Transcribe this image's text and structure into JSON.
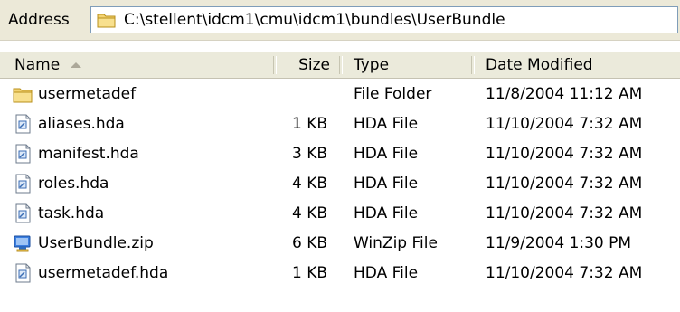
{
  "address": {
    "label": "Address",
    "path": "C:\\stellent\\idcm1\\cmu\\idcm1\\bundles\\UserBundle"
  },
  "columns": {
    "name": "Name",
    "size": "Size",
    "type": "Type",
    "date": "Date Modified",
    "sort_column": "name",
    "sort_direction": "ascending"
  },
  "files": [
    {
      "name": "usermetadef",
      "size": "",
      "type": "File Folder",
      "date": "11/8/2004 11:12 AM",
      "icon": "folder-icon"
    },
    {
      "name": "aliases.hda",
      "size": "1 KB",
      "type": "HDA File",
      "date": "11/10/2004 7:32 AM",
      "icon": "document-icon"
    },
    {
      "name": "manifest.hda",
      "size": "3 KB",
      "type": "HDA File",
      "date": "11/10/2004 7:32 AM",
      "icon": "document-icon"
    },
    {
      "name": "roles.hda",
      "size": "4 KB",
      "type": "HDA File",
      "date": "11/10/2004 7:32 AM",
      "icon": "document-icon"
    },
    {
      "name": "task.hda",
      "size": "4 KB",
      "type": "HDA File",
      "date": "11/10/2004 7:32 AM",
      "icon": "document-icon"
    },
    {
      "name": "UserBundle.zip",
      "size": "6 KB",
      "type": "WinZip File",
      "date": "11/9/2004 1:30 PM",
      "icon": "winzip-icon"
    },
    {
      "name": "usermetadef.hda",
      "size": "1 KB",
      "type": "HDA File",
      "date": "11/10/2004 7:32 AM",
      "icon": "document-icon"
    }
  ]
}
